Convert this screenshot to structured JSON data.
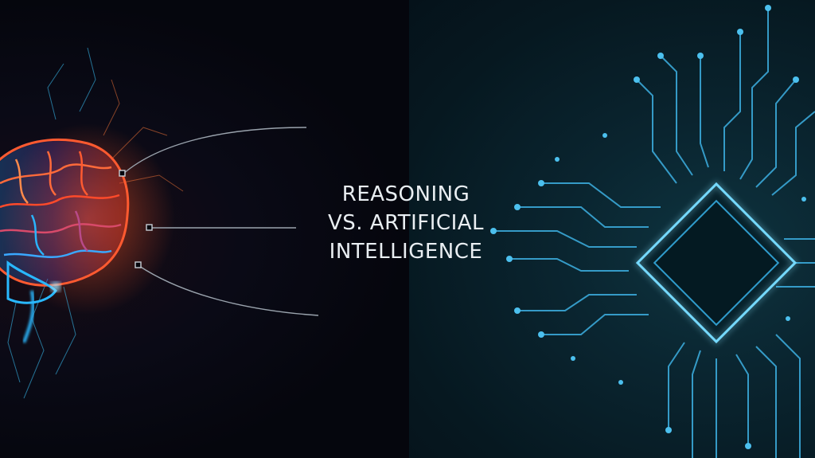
{
  "headline": {
    "line1": "REASONING",
    "line2": "VS. ARTIFICIAL",
    "line3": "INTELLIGENCE"
  },
  "colors": {
    "left_background": "#05060d",
    "right_background": "#061820",
    "brain_warm": "#ff4a2a",
    "brain_cool": "#1fb6ff",
    "circuit": "#3aa8d8",
    "text": "#e9eef2"
  },
  "icons": [
    "brain-icon",
    "circuit-chip-icon"
  ]
}
